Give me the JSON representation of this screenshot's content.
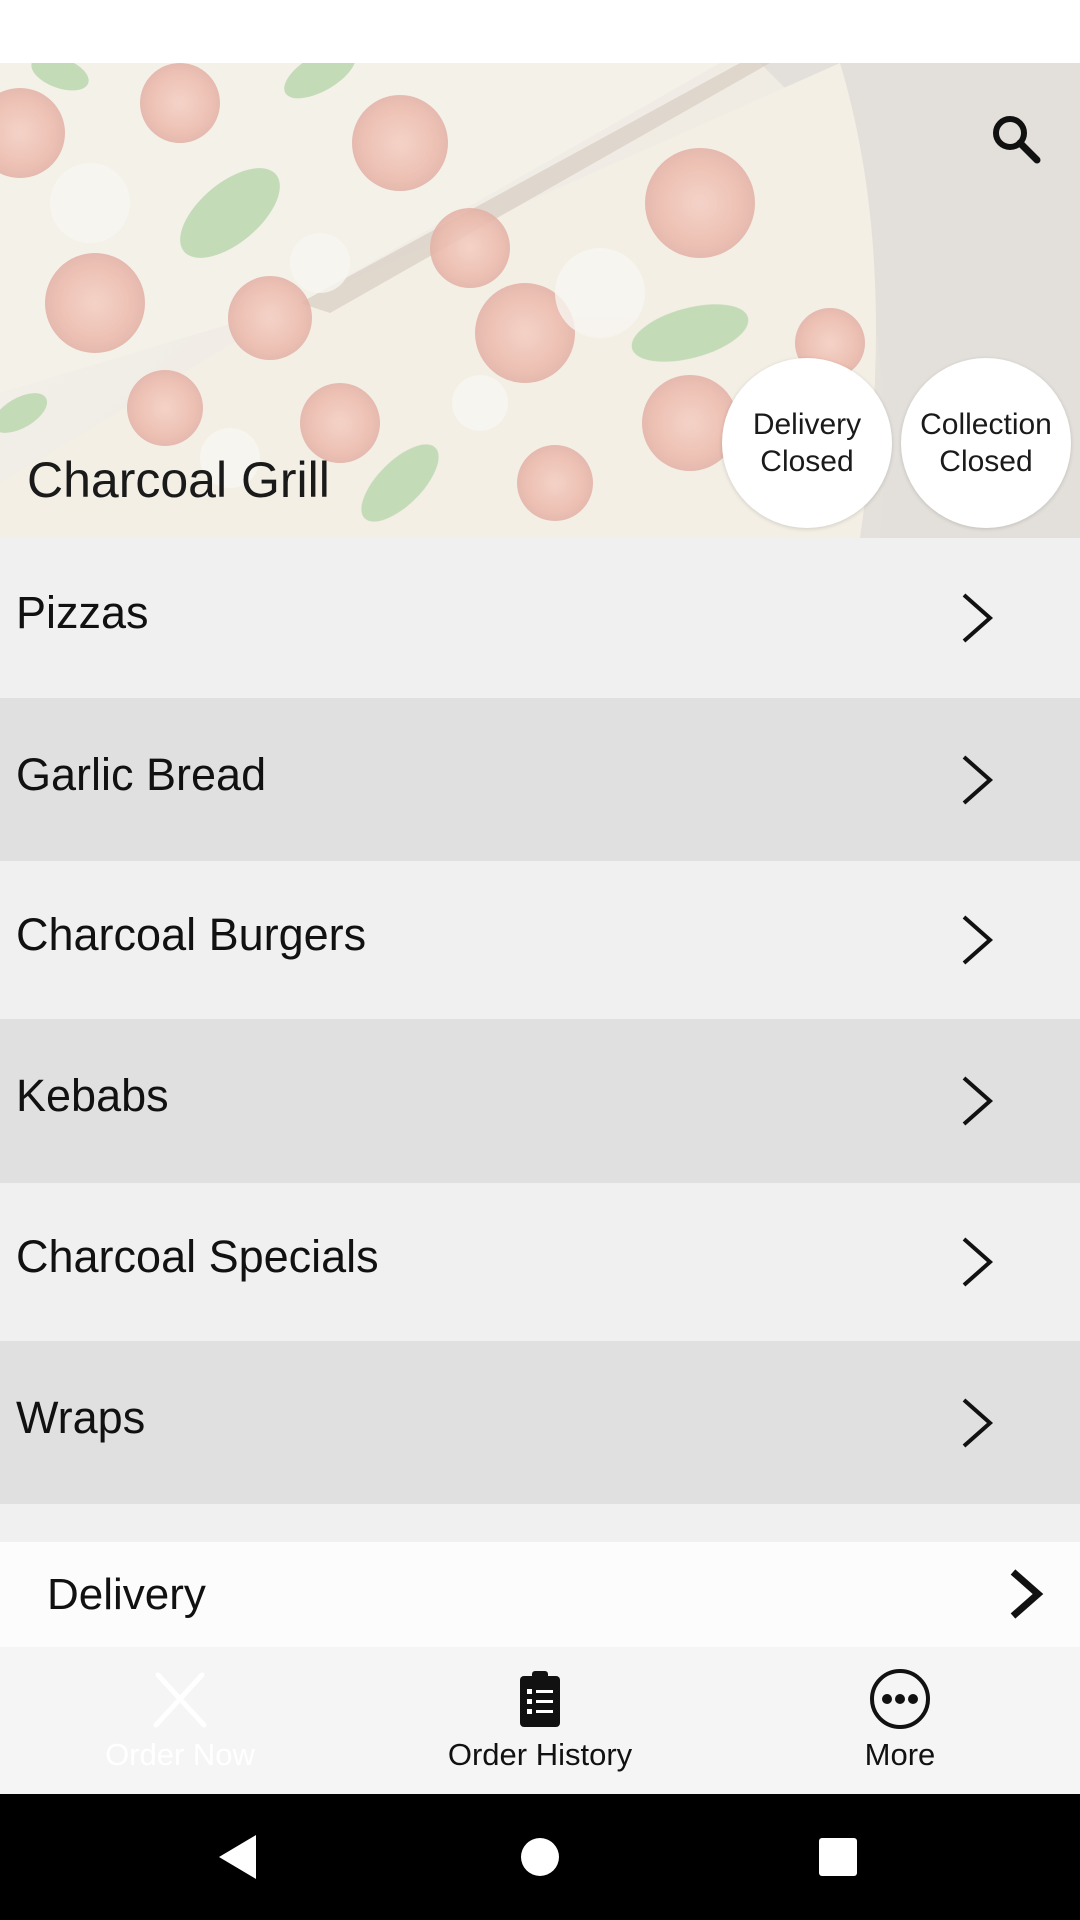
{
  "hero": {
    "restaurant_name": "Charcoal Grill",
    "delivery_status": {
      "line1": "Delivery",
      "line2": "Closed"
    },
    "collection_status": {
      "line1": "Collection",
      "line2": "Closed"
    },
    "search_icon": "search-icon"
  },
  "menu": {
    "categories": [
      {
        "label": "Pizzas"
      },
      {
        "label": "Garlic Bread"
      },
      {
        "label": "Charcoal Burgers"
      },
      {
        "label": "Kebabs"
      },
      {
        "label": "Charcoal Specials"
      },
      {
        "label": "Wraps"
      }
    ]
  },
  "delivery_bar": {
    "label": "Delivery"
  },
  "tabs": {
    "order_now": "Order Now",
    "order_history": "Order History",
    "more": "More"
  },
  "colors": {
    "row_light": "#f0f0f0",
    "row_dark": "#e0e0e0",
    "tabbar_bg": "#f5f5f5",
    "nav_bg": "#000000"
  }
}
